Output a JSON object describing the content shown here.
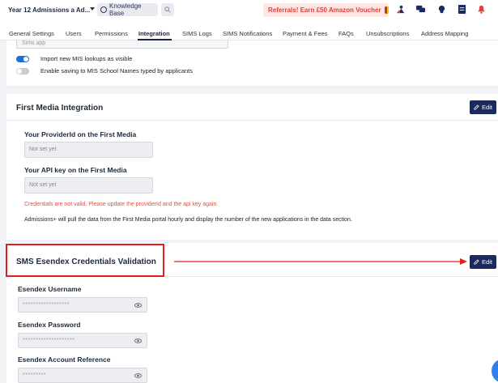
{
  "topbar": {
    "school_name": "Year 12 Admissions a Ad...",
    "knowledge_base": "Knowledge Base",
    "referral": "Referrals! Earn £50 Amazon Voucher"
  },
  "tabs": [
    {
      "label": "General Settings"
    },
    {
      "label": "Users"
    },
    {
      "label": "Permissions"
    },
    {
      "label": "Integration",
      "active": true
    },
    {
      "label": "SIMS Logs"
    },
    {
      "label": "SIMS Notifications"
    },
    {
      "label": "Payment & Fees"
    },
    {
      "label": "FAQs"
    },
    {
      "label": "Unsubscriptions"
    },
    {
      "label": "Address Mapping"
    }
  ],
  "mis": {
    "sims_app_value": "Sims app",
    "toggle_import_label": "Import new MIS lookups as visible",
    "toggle_import_on": true,
    "toggle_saving_label": "Enable saving to MIS School Names typed by applicants",
    "toggle_saving_on": false
  },
  "first_media": {
    "title": "First Media Integration",
    "edit_label": "Edit",
    "provider_label": "Your ProviderId on the First Media",
    "provider_placeholder": "Not set yet",
    "api_label": "Your API key on the First Media",
    "api_placeholder": "Not set yet",
    "error": "Credentials are not valid. Please update the providerId and the api key again.",
    "info": "Admissions+ will pull the data from the First Media portal hourly and display the number of the new applications in the data section."
  },
  "esendex": {
    "title": "SMS Esendex Credentials Validation",
    "edit_label": "Edit",
    "username_label": "Esendex Username",
    "username_value": "******************",
    "password_label": "Esendex Password",
    "password_value": "********************",
    "account_label": "Esendex Account Reference",
    "account_value": "*********"
  },
  "colors": {
    "accent": "#1b2a5e",
    "toggle_on": "#1f6fd8",
    "error": "#e0503a",
    "annotation": "#e02020",
    "referral_bg": "#fde6e3"
  }
}
